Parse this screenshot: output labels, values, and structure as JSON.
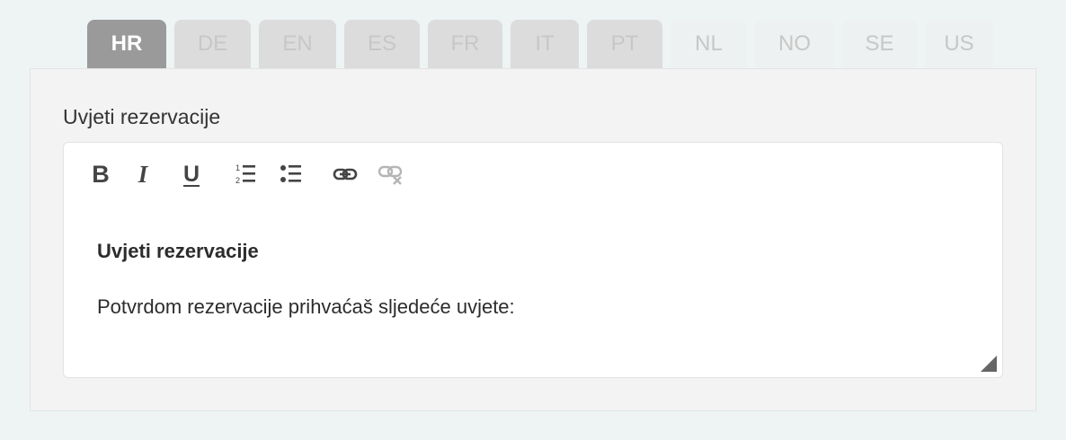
{
  "tabs": [
    {
      "label": "HR",
      "state": "active"
    },
    {
      "label": "DE",
      "state": "inactive"
    },
    {
      "label": "EN",
      "state": "inactive"
    },
    {
      "label": "ES",
      "state": "inactive"
    },
    {
      "label": "FR",
      "state": "inactive"
    },
    {
      "label": "IT",
      "state": "inactive"
    },
    {
      "label": "PT",
      "state": "inactive"
    },
    {
      "label": "NL",
      "state": "faint"
    },
    {
      "label": "NO",
      "state": "faint"
    },
    {
      "label": "SE",
      "state": "faint"
    },
    {
      "label": "US",
      "state": "faint"
    }
  ],
  "field": {
    "label": "Uvjeti rezervacije"
  },
  "toolbar": {
    "bold": "B",
    "italic": "I",
    "underline": "U",
    "icons": [
      "bold-icon",
      "italic-icon",
      "underline-icon",
      "ordered-list-icon",
      "bullet-list-icon",
      "link-icon",
      "unlink-icon"
    ]
  },
  "editor": {
    "heading": "Uvjeti rezervacije",
    "paragraph": "Potvrdom rezervacije prihvaćaš sljedeće uvjete:"
  },
  "colors": {
    "active_tab": "#9a9a9a",
    "inactive_tab": "#dcdcdc",
    "panel": "#f3f3f3",
    "background": "#eef3f3"
  }
}
